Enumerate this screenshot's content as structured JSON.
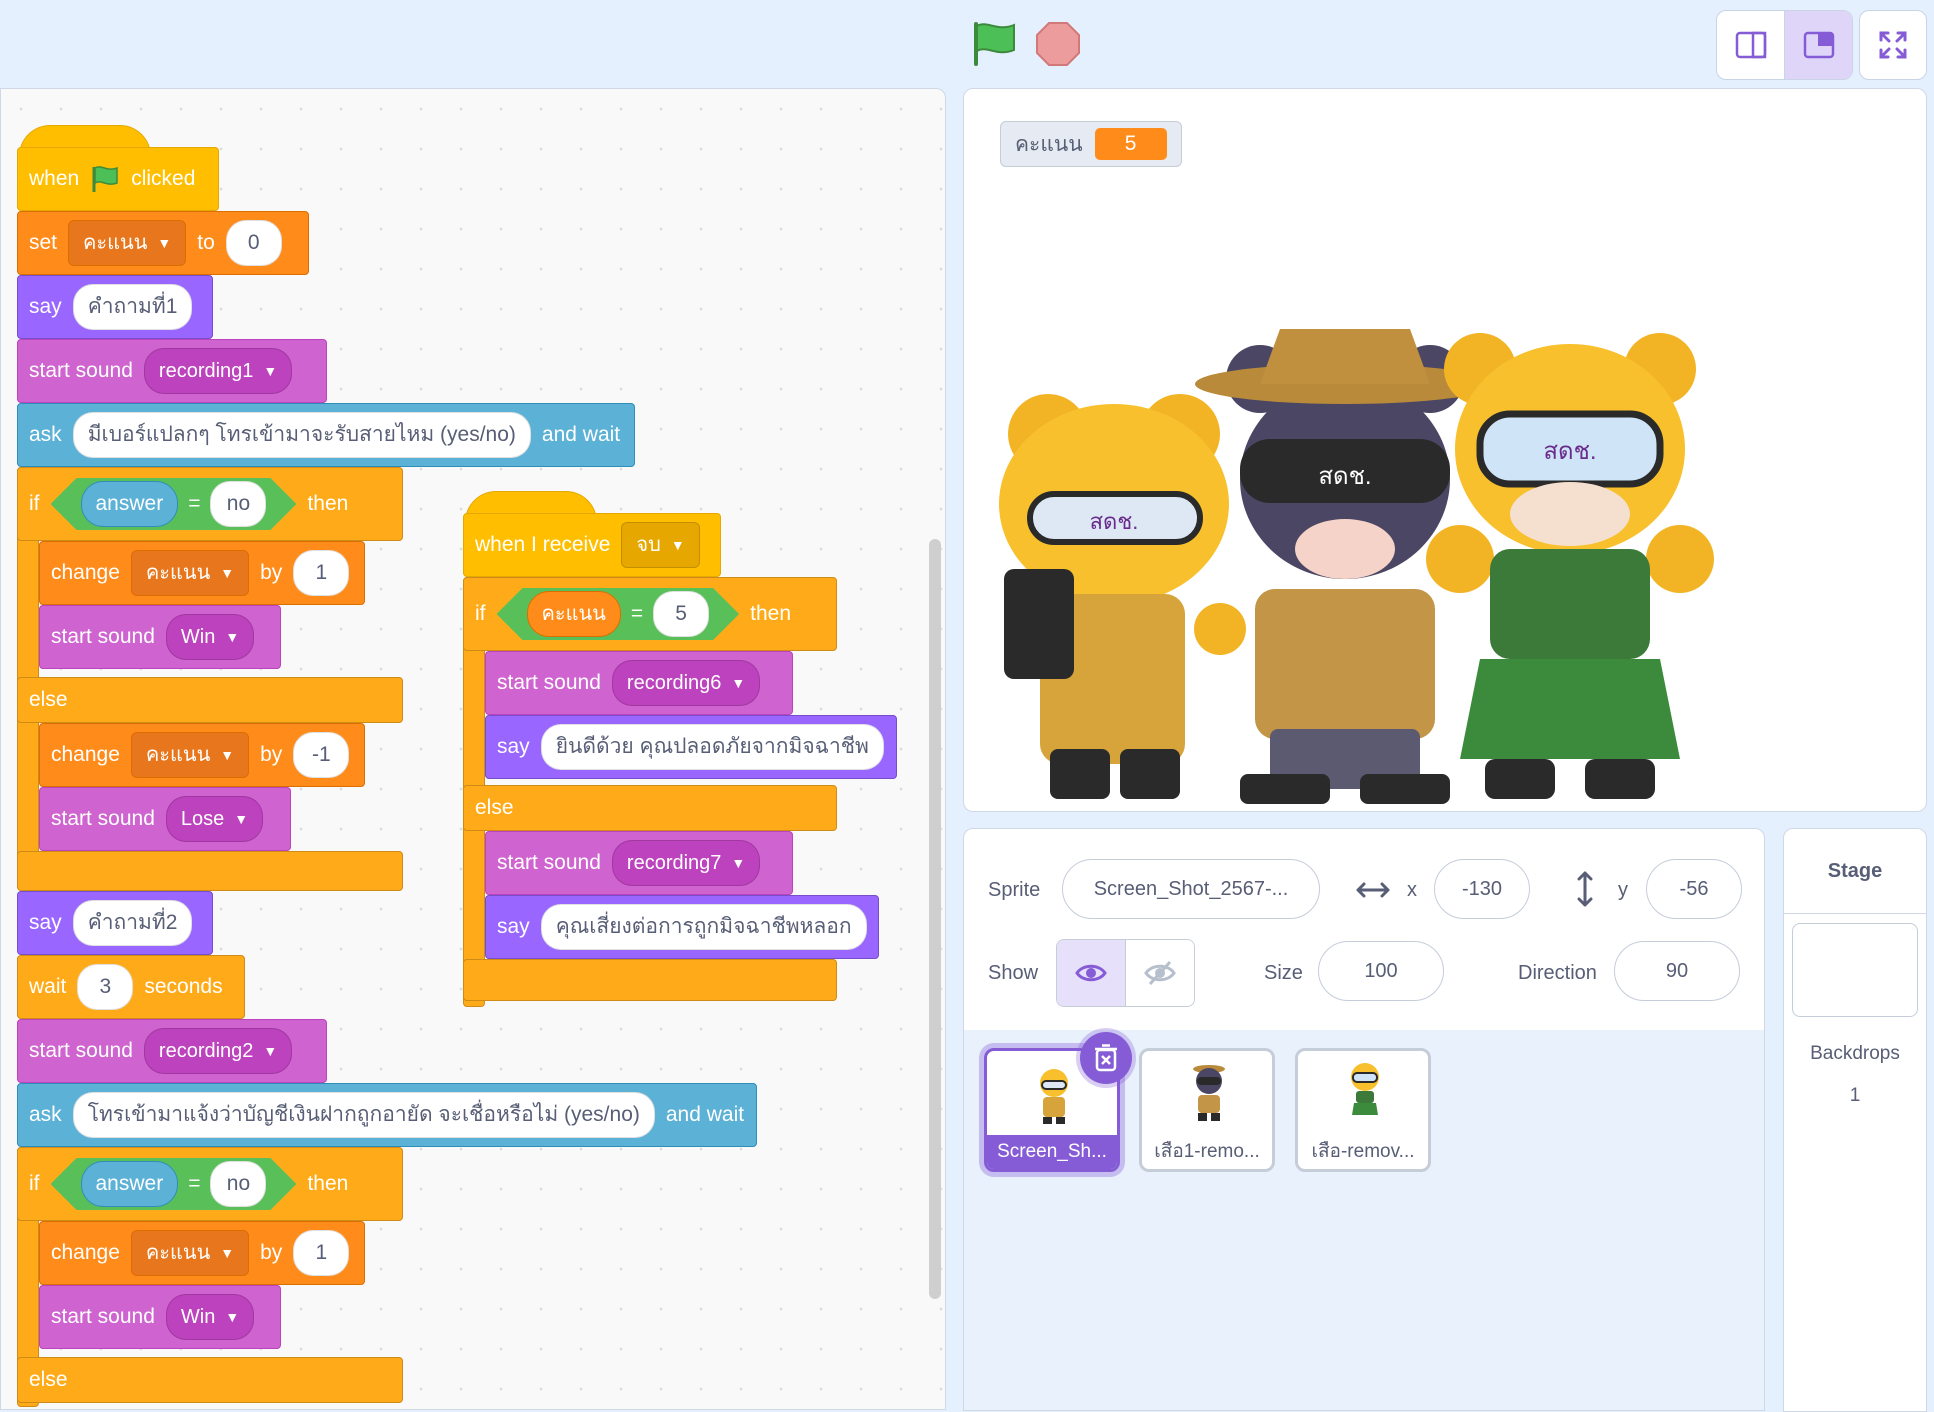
{
  "code": {
    "hat1": {
      "when": "when",
      "clicked": "clicked"
    },
    "set": {
      "op": "set",
      "var": "คะแนน",
      "to": "to",
      "val": "0"
    },
    "say1": {
      "op": "say",
      "msg": "คำถามที่1"
    },
    "sound1": {
      "op": "start sound",
      "snd": "recording1"
    },
    "ask1": {
      "op": "ask",
      "q": "มีเบอร์แปลกๆ โทรเข้ามาจะรับสายไหม (yes/no)",
      "tail": "and wait"
    },
    "if1": {
      "if": "if",
      "rep": "answer",
      "eq": "=",
      "val": "no",
      "then": "then"
    },
    "ch1": {
      "op": "change",
      "var": "คะแนน",
      "by": "by",
      "val": "1"
    },
    "ws1": {
      "op": "start sound",
      "snd": "Win"
    },
    "else1": "else",
    "ch2": {
      "op": "change",
      "var": "คะแนน",
      "by": "by",
      "val": "-1"
    },
    "ls1": {
      "op": "start sound",
      "snd": "Lose"
    },
    "say2": {
      "op": "say",
      "msg": "คำถามที่2"
    },
    "wait": {
      "op": "wait",
      "val": "3",
      "unit": "seconds"
    },
    "sound2": {
      "op": "start sound",
      "snd": "recording2"
    },
    "ask2": {
      "op": "ask",
      "q": "โทรเข้ามาแจ้งว่าบัญชีเงินฝากถูกอายัด จะเชื่อหรือไม่ (yes/no)",
      "tail": "and wait"
    },
    "if2": {
      "if": "if",
      "rep": "answer",
      "eq": "=",
      "val": "no",
      "then": "then"
    },
    "ch3": {
      "op": "change",
      "var": "คะแนน",
      "by": "by",
      "val": "1"
    },
    "ws2": {
      "op": "start sound",
      "snd": "Win"
    },
    "else2": "else",
    "hat2": {
      "label": "when I receive",
      "msg": "จบ"
    },
    "if3": {
      "if": "if",
      "var": "คะแนน",
      "eq": "=",
      "val": "5",
      "then": "then"
    },
    "s6": {
      "op": "start sound",
      "snd": "recording6"
    },
    "say3": {
      "op": "say",
      "msg": "ยินดีด้วย คุณปลอดภัยจากมิจฉาชีพ"
    },
    "else3": "else",
    "s7": {
      "op": "start sound",
      "snd": "recording7"
    },
    "say4": {
      "op": "say",
      "msg": "คุณเสี่ยงต่อการถูกมิจฉาชีพหลอก"
    }
  },
  "stage": {
    "monitor_label": "คะแนน",
    "monitor_value": "5",
    "badge": "สดช."
  },
  "sprite_info": {
    "sprite_label": "Sprite",
    "sprite_name": "Screen_Shot_2567-...",
    "x_label": "x",
    "x_value": "-130",
    "y_label": "y",
    "y_value": "-56",
    "show_label": "Show",
    "size_label": "Size",
    "size_value": "100",
    "direction_label": "Direction",
    "direction_value": "90"
  },
  "sprites": [
    {
      "name": "Screen_Sh..."
    },
    {
      "name": "เสือ1-remo..."
    },
    {
      "name": "เสือ-remov..."
    }
  ],
  "stage_panel": {
    "title": "Stage",
    "backdrops_label": "Backdrops",
    "backdrops_count": "1"
  },
  "colors": {
    "events": "#ffbf00",
    "variables": "#ff8c1a",
    "looks": "#9966ff",
    "sound": "#cf63cf",
    "sensing": "#5cb1d6",
    "control": "#ffab19",
    "operators": "#59c059",
    "accent": "#855cd6"
  }
}
